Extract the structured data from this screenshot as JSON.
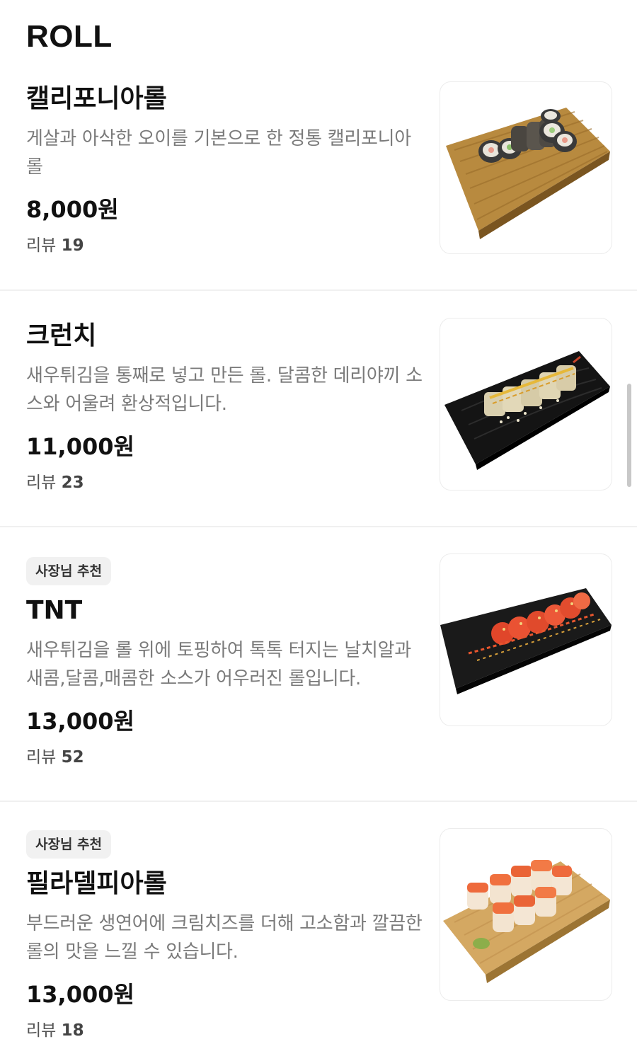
{
  "section": {
    "title": "ROLL"
  },
  "items": [
    {
      "badge": "",
      "name": "캘리포니아롤",
      "description": "게살과 아삭한 오이를 기본으로 한 정통 캘리포니아 롤",
      "price": "8,000원",
      "review_label": "리뷰",
      "review_count": "19",
      "image": "california-roll-on-bamboo-board"
    },
    {
      "badge": "",
      "name": "크런치",
      "description": "새우튀김을 통째로 넣고 만든 롤. 달콤한 데리야끼 소스와 어울려 환상적입니다.",
      "price": "11,000원",
      "review_label": "리뷰",
      "review_count": "23",
      "image": "crunch-roll-on-black-plate"
    },
    {
      "badge": "사장님 추천",
      "name": "TNT",
      "description": "새우튀김을 롤 위에 토핑하여 톡톡 터지는 날치알과 새콤,달콤,매콤한 소스가 어우러진 롤입니다.",
      "price": "13,000원",
      "review_label": "리뷰",
      "review_count": "52",
      "image": "tnt-roll-on-black-plate"
    },
    {
      "badge": "사장님 추천",
      "name": "필라델피아롤",
      "description": "부드러운 생연어에 크림치즈를 더해 고소함과 깔끔한 롤의 맛을 느낄 수 있습니다.",
      "price": "13,000원",
      "review_label": "리뷰",
      "review_count": "18",
      "image": "philadelphia-roll-on-wooden-board"
    }
  ],
  "colors": {
    "text_primary": "#111111",
    "text_secondary": "#7a7a7a",
    "badge_bg": "#f1f1f1",
    "divider": "#f0f0f0"
  }
}
